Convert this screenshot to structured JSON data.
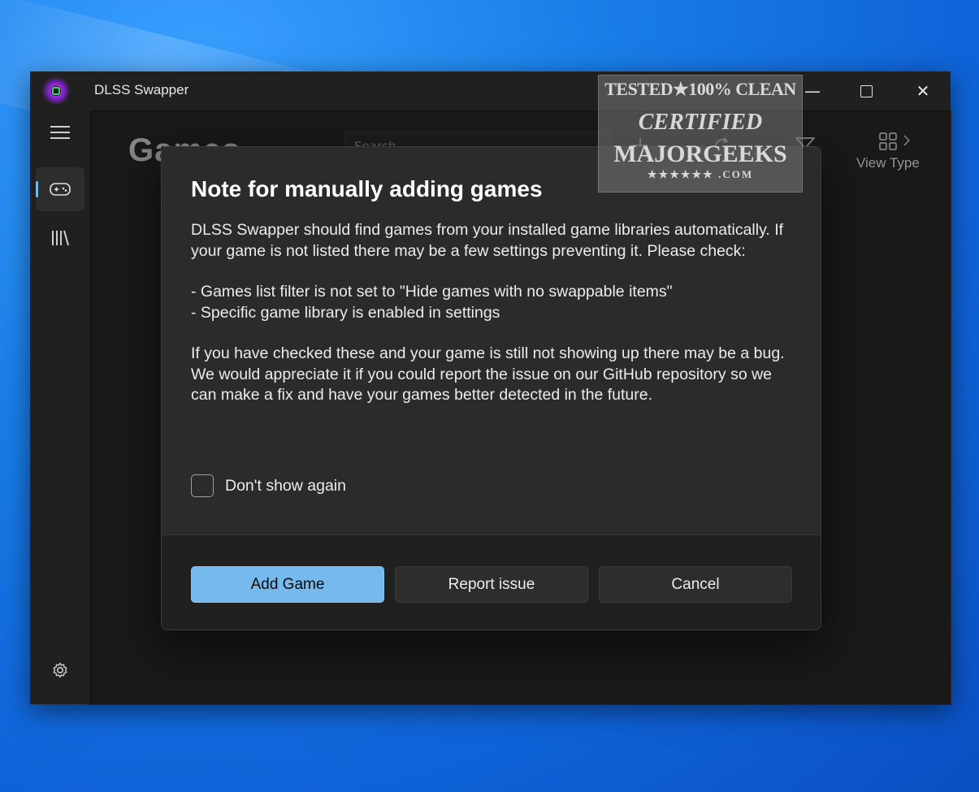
{
  "window": {
    "title": "DLSS Swapper",
    "controls": {
      "minimize": "—",
      "close": "✕"
    }
  },
  "sidebar": {
    "items": [
      {
        "name": "menu",
        "icon": "hamburger-icon"
      },
      {
        "name": "games",
        "icon": "gamepad-icon",
        "selected": true
      },
      {
        "name": "library",
        "icon": "library-icon"
      },
      {
        "name": "settings",
        "icon": "gear-icon"
      }
    ]
  },
  "page": {
    "title": "Games",
    "search_placeholder": "Search",
    "view_type_label": "View Type"
  },
  "dialog": {
    "title": "Note for manually adding games",
    "body": {
      "p1": "DLSS Swapper should find games from your installed game libraries automatically. If your game is not listed there may be a few settings preventing it. Please check:",
      "bullet1": "- Games list filter is not set to \"Hide games with no swappable items\"",
      "bullet2": "- Specific game library is enabled in settings",
      "p2": "If you have checked these and your game is still not showing up there may be a bug. We would appreciate it if you could report the issue on our GitHub repository so we can make a fix and have your games better detected in the future."
    },
    "checkbox_label": "Don't show again",
    "checkbox_checked": false,
    "buttons": {
      "primary": "Add Game",
      "secondary": "Report issue",
      "cancel": "Cancel"
    },
    "accent_color": "#76b9ed"
  },
  "watermark": {
    "line1": "TESTED★100% CLEAN",
    "line2": "CERTIFIED",
    "line3": "MAJORGEEKS",
    "line4": "★★★★★★ .COM"
  }
}
